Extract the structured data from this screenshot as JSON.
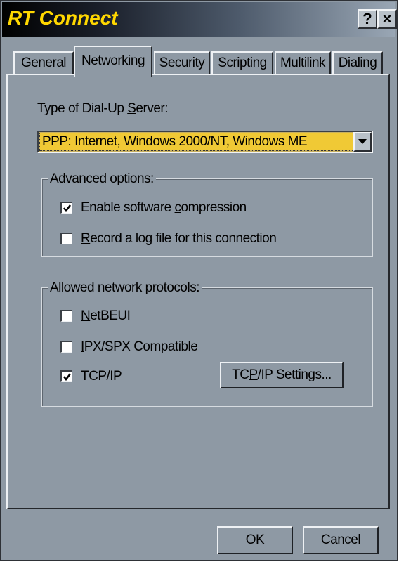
{
  "window": {
    "title": "RT Connect",
    "help_label": "?",
    "close_label": "×"
  },
  "tabs": [
    {
      "label": "General",
      "active": false
    },
    {
      "label": "Networking",
      "active": true
    },
    {
      "label": "Security",
      "active": false
    },
    {
      "label": "Scripting",
      "active": false
    },
    {
      "label": "Multilink",
      "active": false
    },
    {
      "label": "Dialing",
      "active": false
    }
  ],
  "server": {
    "label_pre": "Type of Dial-Up ",
    "label_key": "S",
    "label_post": "erver:",
    "selected": "PPP: Internet, Windows 2000/NT, Windows ME"
  },
  "advanced": {
    "legend": "Advanced options:",
    "compression": {
      "pre": "Enable software ",
      "key": "c",
      "post": "ompression",
      "checked": true
    },
    "logfile": {
      "pre": "",
      "key": "R",
      "post": "ecord a log file for this connection",
      "checked": false
    }
  },
  "protocols": {
    "legend": "Allowed network protocols:",
    "netbeui": {
      "pre": "",
      "key": "N",
      "post": "etBEUI",
      "checked": false
    },
    "ipxspx": {
      "pre": "",
      "key": "I",
      "post": "PX/SPX Compatible",
      "checked": false
    },
    "tcpip": {
      "pre": "",
      "key": "T",
      "post": "CP/IP",
      "checked": true
    },
    "settings_button": {
      "pre": "TC",
      "key": "P",
      "post": "/IP Settings..."
    }
  },
  "footer": {
    "ok_label": "OK",
    "cancel_label": "Cancel"
  },
  "colors": {
    "title_text": "#ffd700",
    "dialog_face": "#8e99a4",
    "combo_highlight": "#f0c935"
  }
}
